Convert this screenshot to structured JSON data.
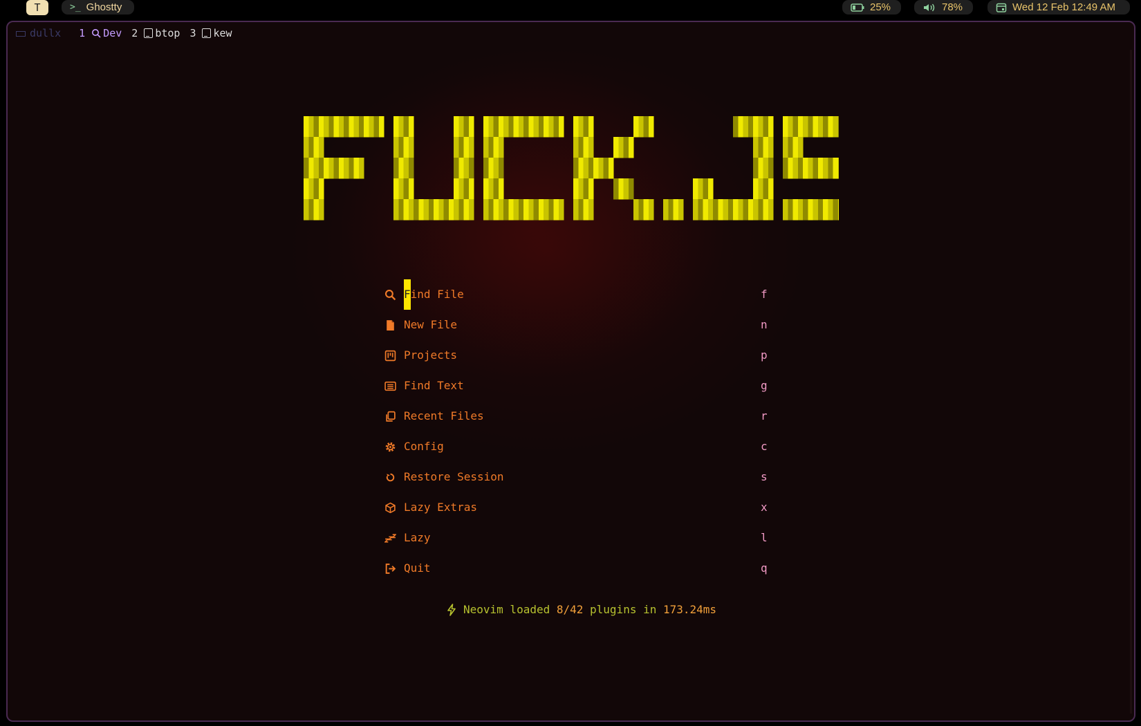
{
  "topbar": {
    "app_letter": "T",
    "app_name": "Ghostty",
    "prompt_glyph": ">_",
    "battery": "25%",
    "volume": "78%",
    "datetime": "Wed 12 Feb 12:49 AM"
  },
  "tmux": {
    "session": "dullx",
    "tabs": [
      {
        "num": "1",
        "label": "Dev",
        "icon": "search-icon",
        "active": true
      },
      {
        "num": "2",
        "label": "btop",
        "icon": "terminal-icon",
        "active": false
      },
      {
        "num": "3",
        "label": "kew",
        "icon": "terminal-icon",
        "active": false
      }
    ]
  },
  "logo": {
    "text": "FUCK.JS",
    "colors": [
      "#f0ea00",
      "#c9c400",
      "#8f8a00",
      "#5a5200",
      "#2e2600"
    ]
  },
  "menu": [
    {
      "label_first": "F",
      "label_rest": "ind File",
      "key": "f",
      "icon": "search-icon"
    },
    {
      "label_first": "",
      "label_rest": "New File",
      "key": "n",
      "icon": "file-icon"
    },
    {
      "label_first": "",
      "label_rest": "Projects",
      "key": "p",
      "icon": "kanban-icon"
    },
    {
      "label_first": "",
      "label_rest": "Find Text",
      "key": "g",
      "icon": "list-icon"
    },
    {
      "label_first": "",
      "label_rest": "Recent Files",
      "key": "r",
      "icon": "copy-icon"
    },
    {
      "label_first": "",
      "label_rest": "Config",
      "key": "c",
      "icon": "gear-icon"
    },
    {
      "label_first": "",
      "label_rest": "Restore Session",
      "key": "s",
      "icon": "restore-icon"
    },
    {
      "label_first": "",
      "label_rest": "Lazy Extras",
      "key": "x",
      "icon": "cube-icon"
    },
    {
      "label_first": "",
      "label_rest": "Lazy",
      "key": "l",
      "icon": "sleep-icon"
    },
    {
      "label_first": "",
      "label_rest": "Quit",
      "key": "q",
      "icon": "exit-icon"
    }
  ],
  "footer": {
    "prefix": "Neovim loaded ",
    "plugins": "8/42",
    "middle": " plugins in ",
    "time": "173.24ms"
  }
}
